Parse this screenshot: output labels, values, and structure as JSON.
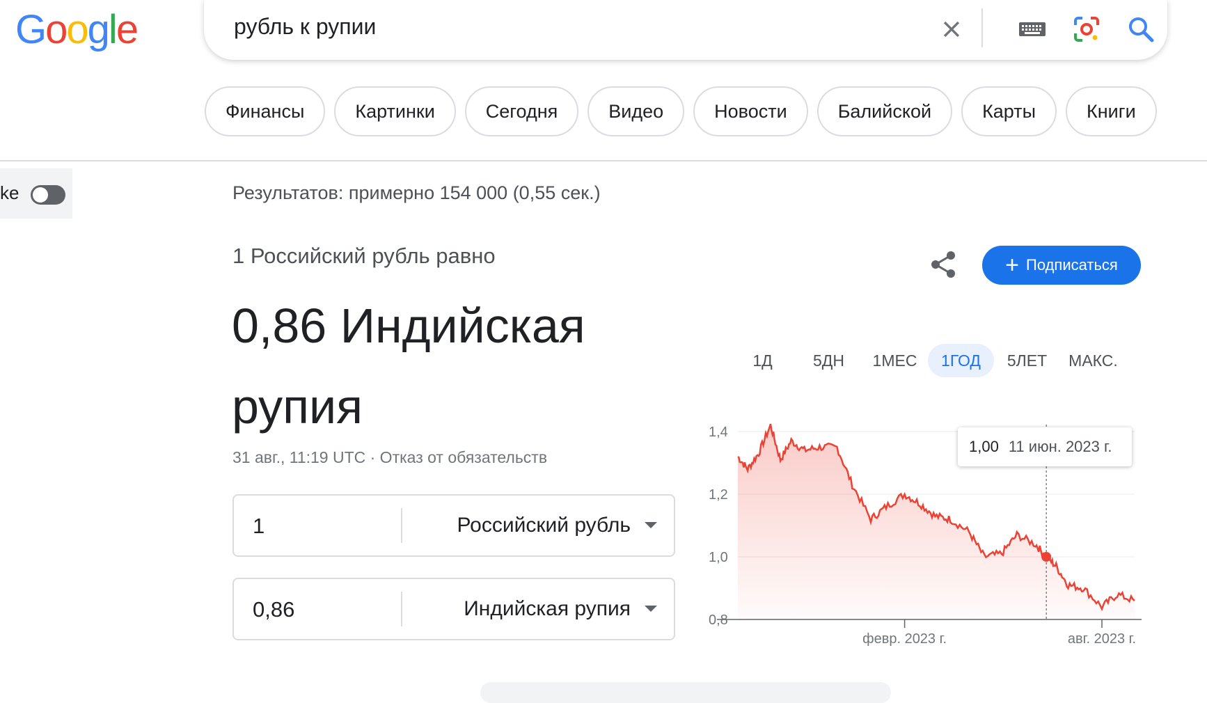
{
  "logo": {
    "letters": [
      "G",
      "o",
      "o",
      "g",
      "l",
      "e"
    ],
    "colors": [
      "#4285F4",
      "#EA4335",
      "#FBBC05",
      "#4285F4",
      "#34A853",
      "#EA4335"
    ]
  },
  "search": {
    "query": "рубль к рупии"
  },
  "chips": [
    "Финансы",
    "Картинки",
    "Сегодня",
    "Видео",
    "Новости",
    "Балийской",
    "Карты",
    "Книги"
  ],
  "toggle": {
    "label": "ke"
  },
  "stats": "Результатов: примерно 154 000 (0,55 сек.)",
  "converter": {
    "equals_text": "1 Российский рубль равно",
    "result": "0,86 Индийская рупия",
    "meta": "31 авг., 11:19 UTC · Отказ от обязательств",
    "from": {
      "value": "1",
      "currency": "Российский рубль"
    },
    "to": {
      "value": "0,86",
      "currency": "Индийская рупия"
    }
  },
  "subscribe_label": "Подписаться",
  "ranges": [
    "1Д",
    "5ДН",
    "1МЕС",
    "1ГОД",
    "5ЛЕТ",
    "МАКС."
  ],
  "active_range": "1ГОД",
  "tooltip": {
    "value": "1,00",
    "date": "11 июн. 2023 г."
  },
  "chart_data": {
    "type": "area",
    "title": "",
    "xlabel": "",
    "ylabel": "",
    "ylim": [
      0.8,
      1.4
    ],
    "y_ticks": [
      "1,4",
      "1,2",
      "1,0",
      "0,8"
    ],
    "x_ticks": [
      "февр. 2023 г.",
      "авг. 2023 г."
    ],
    "color": "#ea4335",
    "x": [
      "2022-09-01",
      "2022-09-10",
      "2022-09-20",
      "2022-10-01",
      "2022-10-10",
      "2022-10-20",
      "2022-11-01",
      "2022-11-15",
      "2022-12-01",
      "2022-12-15",
      "2023-01-01",
      "2023-01-15",
      "2023-02-01",
      "2023-02-15",
      "2023-03-01",
      "2023-03-15",
      "2023-04-01",
      "2023-04-15",
      "2023-05-01",
      "2023-05-15",
      "2023-06-01",
      "2023-06-11",
      "2023-06-20",
      "2023-07-01",
      "2023-07-15",
      "2023-08-01",
      "2023-08-15",
      "2023-08-31"
    ],
    "values": [
      1.32,
      1.28,
      1.33,
      1.42,
      1.31,
      1.37,
      1.34,
      1.35,
      1.35,
      1.23,
      1.12,
      1.16,
      1.2,
      1.17,
      1.13,
      1.12,
      1.08,
      1.0,
      1.01,
      1.07,
      1.04,
      1.0,
      0.97,
      0.91,
      0.9,
      0.84,
      0.88,
      0.86
    ],
    "highlight": {
      "x": "2023-06-11",
      "y": 1.0
    }
  }
}
